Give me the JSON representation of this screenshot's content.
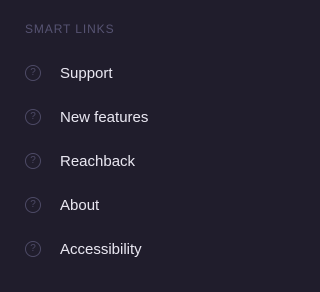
{
  "smart_links": {
    "heading": "SMART LINKS",
    "colors": {
      "background": "#201d2c",
      "heading": "#565372",
      "icon": "#4d4a66",
      "label": "#e8e6f0"
    },
    "items": [
      {
        "label": "Support",
        "icon": "question-circle-icon",
        "glyph": "?"
      },
      {
        "label": "New features",
        "icon": "question-circle-icon",
        "glyph": "?"
      },
      {
        "label": "Reachback",
        "icon": "question-circle-icon",
        "glyph": "?"
      },
      {
        "label": "About",
        "icon": "question-circle-icon",
        "glyph": "?"
      },
      {
        "label": "Accessibility",
        "icon": "question-circle-icon",
        "glyph": "?"
      }
    ]
  }
}
